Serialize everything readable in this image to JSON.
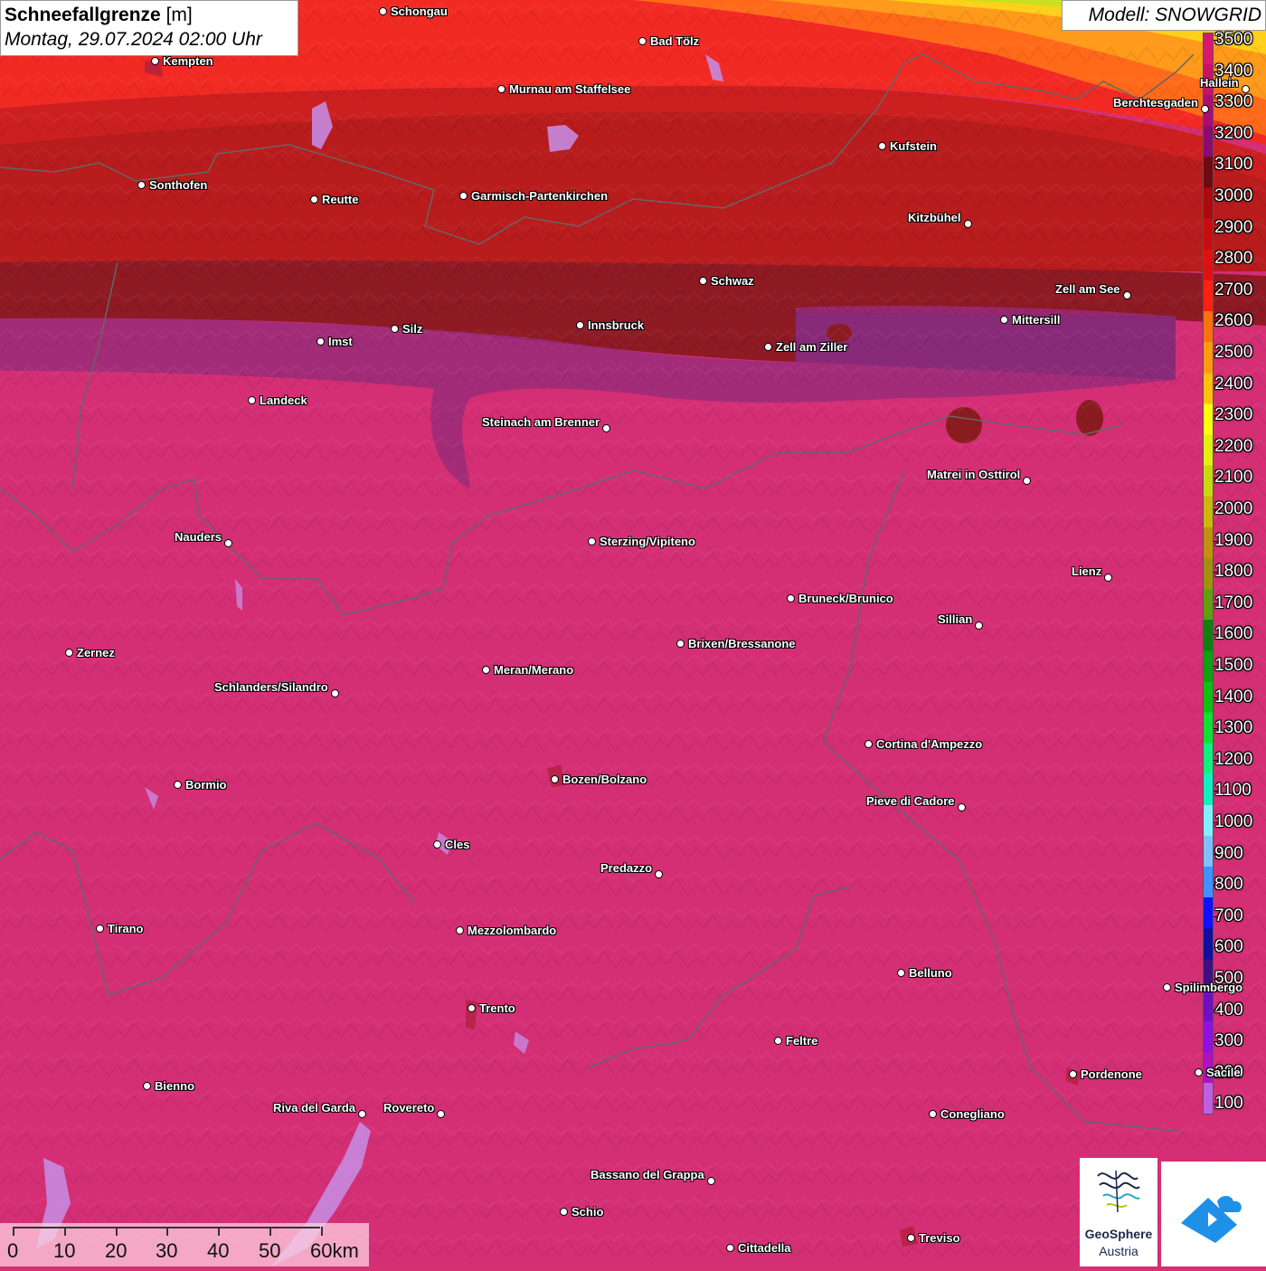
{
  "header": {
    "title_bold": "Schneefallgrenze",
    "title_unit": " [m]",
    "datetime": "Montag, 29.07.2024 02:00 Uhr"
  },
  "model_label": "Modell: SNOWGRID",
  "legend": {
    "unit": "m",
    "levels": [
      {
        "label": "3500",
        "color": "#d8176e"
      },
      {
        "label": "3400",
        "color": "#c8116a"
      },
      {
        "label": "3300",
        "color": "#a80d74"
      },
      {
        "label": "3200",
        "color": "#8a0a70"
      },
      {
        "label": "3100",
        "color": "#6e0a10"
      },
      {
        "label": "3000",
        "color": "#a80a10"
      },
      {
        "label": "2900",
        "color": "#c80c10"
      },
      {
        "label": "2800",
        "color": "#e01010"
      },
      {
        "label": "2700",
        "color": "#ff2010"
      },
      {
        "label": "2600",
        "color": "#ff7010"
      },
      {
        "label": "2500",
        "color": "#ff9a10"
      },
      {
        "label": "2400",
        "color": "#ffc010"
      },
      {
        "label": "2300",
        "color": "#ffff10"
      },
      {
        "label": "2200",
        "color": "#e0f010"
      },
      {
        "label": "2100",
        "color": "#c8d810"
      },
      {
        "label": "2000",
        "color": "#c8b810"
      },
      {
        "label": "1900",
        "color": "#c09010"
      },
      {
        "label": "1800",
        "color": "#a09010"
      },
      {
        "label": "1700",
        "color": "#60a010"
      },
      {
        "label": "1600",
        "color": "#108010"
      },
      {
        "label": "1500",
        "color": "#10a010"
      },
      {
        "label": "1400",
        "color": "#10c010"
      },
      {
        "label": "1300",
        "color": "#10e030"
      },
      {
        "label": "1200",
        "color": "#10f080"
      },
      {
        "label": "1100",
        "color": "#10f0c0"
      },
      {
        "label": "1000",
        "color": "#80f0ff"
      },
      {
        "label": "900",
        "color": "#80c0ff"
      },
      {
        "label": "800",
        "color": "#4090ff"
      },
      {
        "label": "700",
        "color": "#1010ff"
      },
      {
        "label": "600",
        "color": "#1010a0"
      },
      {
        "label": "500",
        "color": "#401080"
      },
      {
        "label": "400",
        "color": "#7010c0"
      },
      {
        "label": "300",
        "color": "#9010e0"
      },
      {
        "label": "200",
        "color": "#b010c0"
      },
      {
        "label": "100",
        "color": "#c060e0"
      }
    ]
  },
  "cities": [
    {
      "name": "Schongau",
      "side": "right"
    },
    {
      "name": "Bad Tölz",
      "side": "right"
    },
    {
      "name": "Kempten",
      "side": "right"
    },
    {
      "name": "Murnau am Staffelsee",
      "side": "right"
    },
    {
      "name": "Hallein",
      "side": "left"
    },
    {
      "name": "Berchtesgaden",
      "side": "left"
    },
    {
      "name": "Kufstein",
      "side": "right"
    },
    {
      "name": "Sonthofen",
      "side": "right"
    },
    {
      "name": "Reutte",
      "side": "right"
    },
    {
      "name": "Garmisch-Partenkirchen",
      "side": "right"
    },
    {
      "name": "Kitzbühel",
      "side": "left"
    },
    {
      "name": "Schwaz",
      "side": "right"
    },
    {
      "name": "Zell am See",
      "side": "left"
    },
    {
      "name": "Mittersill",
      "side": "right"
    },
    {
      "name": "Innsbruck",
      "side": "right"
    },
    {
      "name": "Imst",
      "side": "right"
    },
    {
      "name": "Silz",
      "side": "right"
    },
    {
      "name": "Zell am Ziller",
      "side": "right"
    },
    {
      "name": "Landeck",
      "side": "right"
    },
    {
      "name": "Steinach am Brenner",
      "side": "left"
    },
    {
      "name": "Matrei in Osttirol",
      "side": "left"
    },
    {
      "name": "Nauders",
      "side": "left"
    },
    {
      "name": "Sterzing/Vipiteno",
      "side": "right"
    },
    {
      "name": "Lienz",
      "side": "left"
    },
    {
      "name": "Bruneck/Brunico",
      "side": "right"
    },
    {
      "name": "Sillian",
      "side": "left"
    },
    {
      "name": "Brixen/Bressanone",
      "side": "right"
    },
    {
      "name": "Zernez",
      "side": "right"
    },
    {
      "name": "Meran/Merano",
      "side": "right"
    },
    {
      "name": "Schlanders/Silandro",
      "side": "left"
    },
    {
      "name": "Cortina d'Ampezzo",
      "side": "right"
    },
    {
      "name": "Bozen/Bolzano",
      "side": "right"
    },
    {
      "name": "Bormio",
      "side": "right"
    },
    {
      "name": "Pieve di Cadore",
      "side": "left"
    },
    {
      "name": "Cles",
      "side": "right"
    },
    {
      "name": "Predazzo",
      "side": "left"
    },
    {
      "name": "Tirano",
      "side": "right"
    },
    {
      "name": "Mezzolombardo",
      "side": "right"
    },
    {
      "name": "Belluno",
      "side": "right"
    },
    {
      "name": "Spilimbergo",
      "side": "right"
    },
    {
      "name": "Trento",
      "side": "right"
    },
    {
      "name": "Feltre",
      "side": "right"
    },
    {
      "name": "Pordenone",
      "side": "right"
    },
    {
      "name": "Bienno",
      "side": "right"
    },
    {
      "name": "Riva del Garda",
      "side": "left"
    },
    {
      "name": "Rovereto",
      "side": "left"
    },
    {
      "name": "Conegliano",
      "side": "right"
    },
    {
      "name": "Bassano del Grappa",
      "side": "left"
    },
    {
      "name": "Schio",
      "side": "right"
    },
    {
      "name": "Treviso",
      "side": "right"
    },
    {
      "name": "Cittadella",
      "side": "right"
    },
    {
      "name": "Sacile",
      "side": "right"
    }
  ],
  "scale_bar": {
    "labels": [
      "0",
      "10",
      "20",
      "30",
      "40",
      "50",
      "60km"
    ]
  },
  "logos": {
    "geosphere_line1": "GeoSphere",
    "geosphere_line2": "Austria"
  }
}
